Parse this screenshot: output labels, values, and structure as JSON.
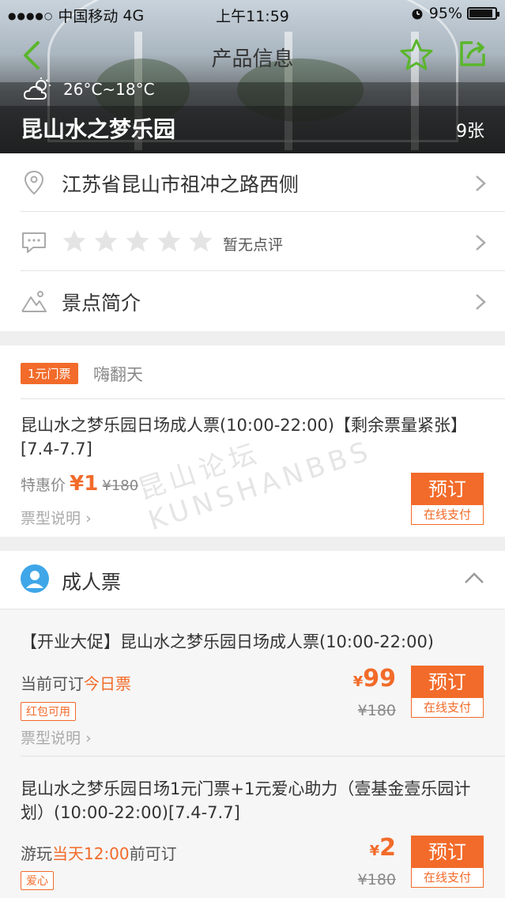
{
  "status_bar": {
    "carrier": "中国移动",
    "network": "4G",
    "time": "上午11:59",
    "battery": "95%"
  },
  "nav": {
    "title": "产品信息"
  },
  "hero": {
    "weather": "26°C~18°C",
    "park_name": "昆山水之梦乐园",
    "photo_count": "9张"
  },
  "info": {
    "address": "江苏省昆山市祖冲之路西侧",
    "rating_stars": 0,
    "rating_text": "暂无点评",
    "intro": "景点简介"
  },
  "promo": {
    "tag": "1元门票",
    "name": "嗨翻天",
    "ticket_title": "昆山水之梦乐园日场成人票(10:00-22:00)【剩余票量紧张】[7.4-7.7]",
    "price_label": "特惠价",
    "price": "¥1",
    "old_price": "¥180",
    "type_note": "票型说明",
    "book_label": "预订",
    "pay_label": "在线支付"
  },
  "adult": {
    "header": "成人票",
    "tickets": [
      {
        "title": "【开业大促】昆山水之梦乐园日场成人票(10:00-22:00)",
        "avail_prefix": "当前可订",
        "avail_highlight": "今日票",
        "avail_suffix": "",
        "badge": "红包可用",
        "price_symbol": "¥",
        "price": "99",
        "old_price": "¥180",
        "type_note": "票型说明",
        "book_label": "预订",
        "pay_label": "在线支付"
      },
      {
        "title": "昆山水之梦乐园日场1元门票+1元爱心助力（壹基金壹乐园计划）(10:00-22:00)[7.4-7.7]",
        "avail_prefix": "游玩",
        "avail_highlight": "当天12:00",
        "avail_suffix": "前可订",
        "badge": "爱心",
        "price_symbol": "¥",
        "price": "2",
        "old_price": "¥180",
        "book_label": "预订",
        "pay_label": "在线支付"
      }
    ]
  },
  "watermark": "昆山论坛 KUNSHANBBS",
  "colors": {
    "accent": "#f26b2a",
    "nav_icon": "#5ab62c",
    "avatar": "#3fa6e8"
  }
}
